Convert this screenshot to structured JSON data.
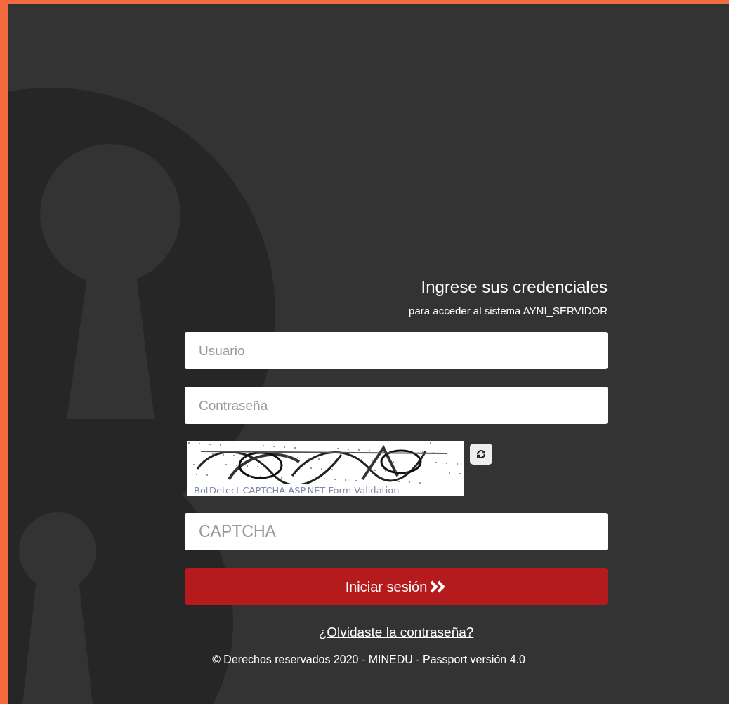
{
  "heading": "Ingrese sus credenciales",
  "subheading": "para acceder al sistema AYNI_SERVIDOR",
  "username": {
    "placeholder": "Usuario"
  },
  "password": {
    "placeholder": "Contraseña"
  },
  "captcha": {
    "kind": "picture",
    "caption": "BotDetect CAPTCHA ASP.NET Form Validation"
  },
  "captcha_field": {
    "placeholder": "CAPTCHA"
  },
  "login_button": {
    "label": "Iniciar sesión"
  },
  "forgot_link": "¿Olvidaste la contraseña?",
  "footer": "© Derechos reservados 2020 - MINEDU - Passport versión 4.0"
}
